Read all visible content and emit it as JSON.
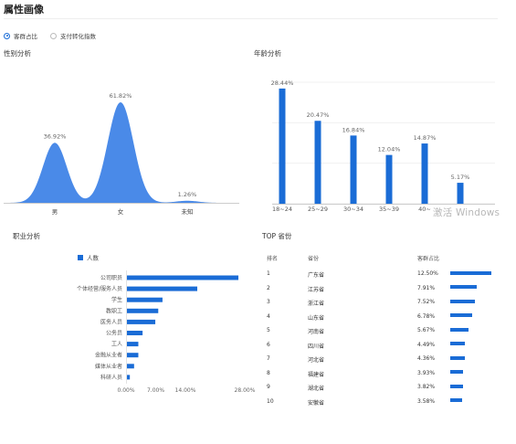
{
  "header": {
    "title": "属性画像"
  },
  "metric_toggle": {
    "options": [
      {
        "label": "客群占比",
        "selected": true
      },
      {
        "label": "支付转化指数",
        "selected": false
      }
    ]
  },
  "gender": {
    "title": "性别分析",
    "labels": [
      "男",
      "女",
      "未知"
    ],
    "values_text": [
      "36.92%",
      "61.82%",
      "1.26%"
    ]
  },
  "age": {
    "title": "年龄分析",
    "categories": [
      "18~24",
      "25~29",
      "30~34",
      "35~39",
      "40~",
      ""
    ],
    "values_text": [
      "28.44%",
      "20.47%",
      "16.84%",
      "12.04%",
      "14.87%",
      "5.17%"
    ]
  },
  "occupation": {
    "title": "职业分析",
    "legend": "人数",
    "categories": [
      "公司职员",
      "个体经营/服务人员",
      "学生",
      "教职工",
      "医务人员",
      "公务员",
      "工人",
      "金融从业者",
      "媒体从业者",
      "科研人员"
    ],
    "x_ticks": [
      "0.00%",
      "7.00%",
      "14.00%",
      "28.00%"
    ]
  },
  "provinces": {
    "title": "TOP 省份",
    "headers": {
      "rank": "排名",
      "name": "省份",
      "share": "客群占比"
    },
    "rows": [
      {
        "rank": "1",
        "name": "广东省",
        "share": "12.50%"
      },
      {
        "rank": "2",
        "name": "江苏省",
        "share": "7.91%"
      },
      {
        "rank": "3",
        "name": "浙江省",
        "share": "7.52%"
      },
      {
        "rank": "4",
        "name": "山东省",
        "share": "6.78%"
      },
      {
        "rank": "5",
        "name": "河南省",
        "share": "5.67%"
      },
      {
        "rank": "6",
        "name": "四川省",
        "share": "4.49%"
      },
      {
        "rank": "7",
        "name": "河北省",
        "share": "4.36%"
      },
      {
        "rank": "8",
        "name": "福建省",
        "share": "3.93%"
      },
      {
        "rank": "9",
        "name": "湖北省",
        "share": "3.82%"
      },
      {
        "rank": "10",
        "name": "安徽省",
        "share": "3.58%"
      }
    ]
  },
  "watermark": "激活 Windows",
  "chart_data": [
    {
      "type": "area",
      "title": "性别分析",
      "categories": [
        "男",
        "女",
        "未知"
      ],
      "values": [
        36.92,
        61.82,
        1.26
      ],
      "unit": "%",
      "color": "#4a8ae8"
    },
    {
      "type": "bar",
      "title": "年龄分析",
      "categories": [
        "18~24",
        "25~29",
        "30~34",
        "35~39",
        "40~",
        ""
      ],
      "values": [
        28.44,
        20.47,
        16.84,
        12.04,
        14.87,
        5.17
      ],
      "unit": "%",
      "ylim": [
        0,
        30
      ],
      "grid": true,
      "color": "#1a6cd6"
    },
    {
      "type": "bar",
      "orientation": "horizontal",
      "title": "职业分析",
      "legend": [
        "人数"
      ],
      "categories": [
        "公司职员",
        "个体经营/服务人员",
        "学生",
        "教职工",
        "医务人员",
        "公务员",
        "工人",
        "金融从业者",
        "媒体从业者",
        "科研人员"
      ],
      "values": [
        26.5,
        16.8,
        8.6,
        7.6,
        6.9,
        3.9,
        2.9,
        2.9,
        1.9,
        0.9
      ],
      "xlim": [
        0,
        28
      ],
      "x_ticks": [
        0,
        7,
        14,
        28
      ],
      "color": "#1a6cd6"
    },
    {
      "type": "bar",
      "orientation": "horizontal",
      "title": "TOP 省份",
      "categories": [
        "广东省",
        "江苏省",
        "浙江省",
        "山东省",
        "河南省",
        "四川省",
        "河北省",
        "福建省",
        "湖北省",
        "安徽省"
      ],
      "values": [
        12.5,
        7.91,
        7.52,
        6.78,
        5.67,
        4.49,
        4.36,
        3.93,
        3.82,
        3.58
      ],
      "unit": "%",
      "xlim": [
        0,
        12.5
      ],
      "color": "#1a6cd6"
    }
  ]
}
